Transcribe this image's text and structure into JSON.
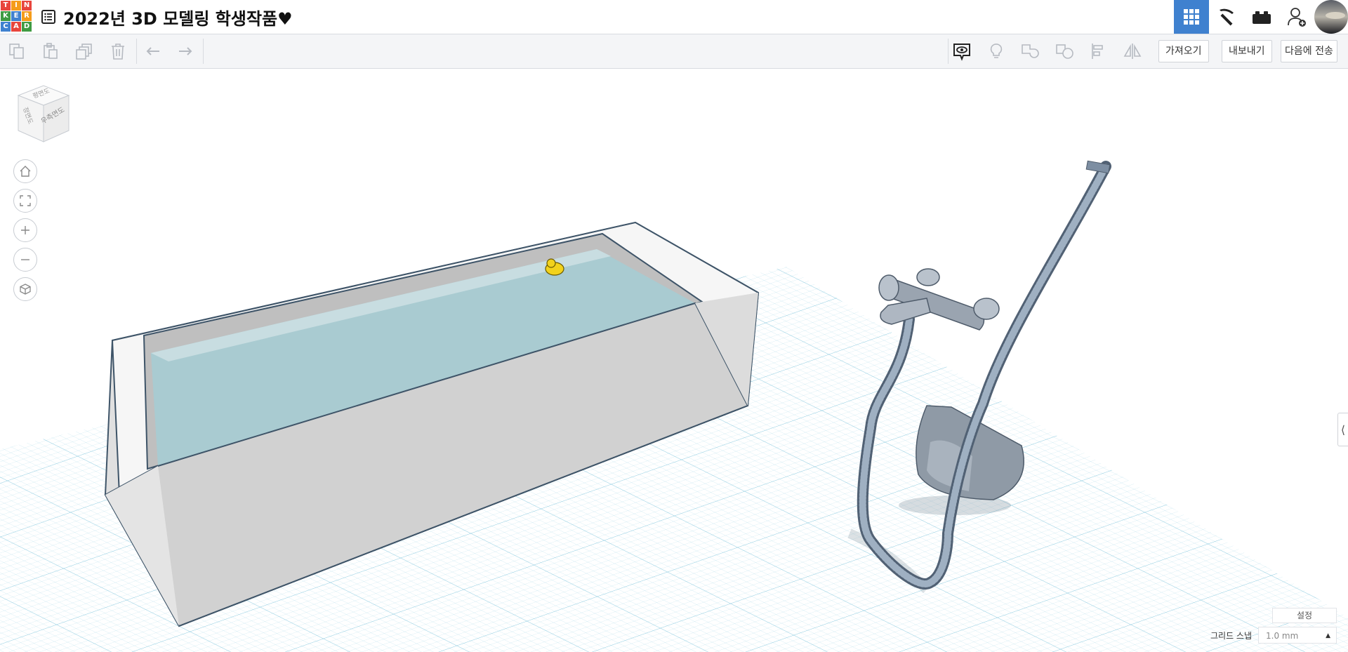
{
  "app": {
    "logo_letters": [
      "T",
      "I",
      "N",
      "K",
      "E",
      "R",
      "C",
      "A",
      "D"
    ],
    "logo_colors": [
      "#e8453c",
      "#f59c1a",
      "#e8453c",
      "#3f9b43",
      "#3f81cf",
      "#f59c1a",
      "#3f81cf",
      "#e8453c",
      "#3f9b43"
    ],
    "design_title": "2022년 3D 모델링 학생작품♥"
  },
  "toolbar": {
    "import_label": "가져오기",
    "export_label": "내보내기",
    "send_to_label": "다음에 전송"
  },
  "viewcube": {
    "top_label": "평면도",
    "front_label": "정면도",
    "right_label": "우측면도"
  },
  "footer": {
    "settings_label": "설정",
    "grid_snap_label": "그리드 스냅",
    "grid_snap_value": "1.0 mm"
  },
  "colors": {
    "accent": "#3f81cf",
    "grid": "#bfe3ee",
    "tub_body": "#d3d3d3",
    "water": "#a9cbd1",
    "duck": "#f2d21c"
  }
}
